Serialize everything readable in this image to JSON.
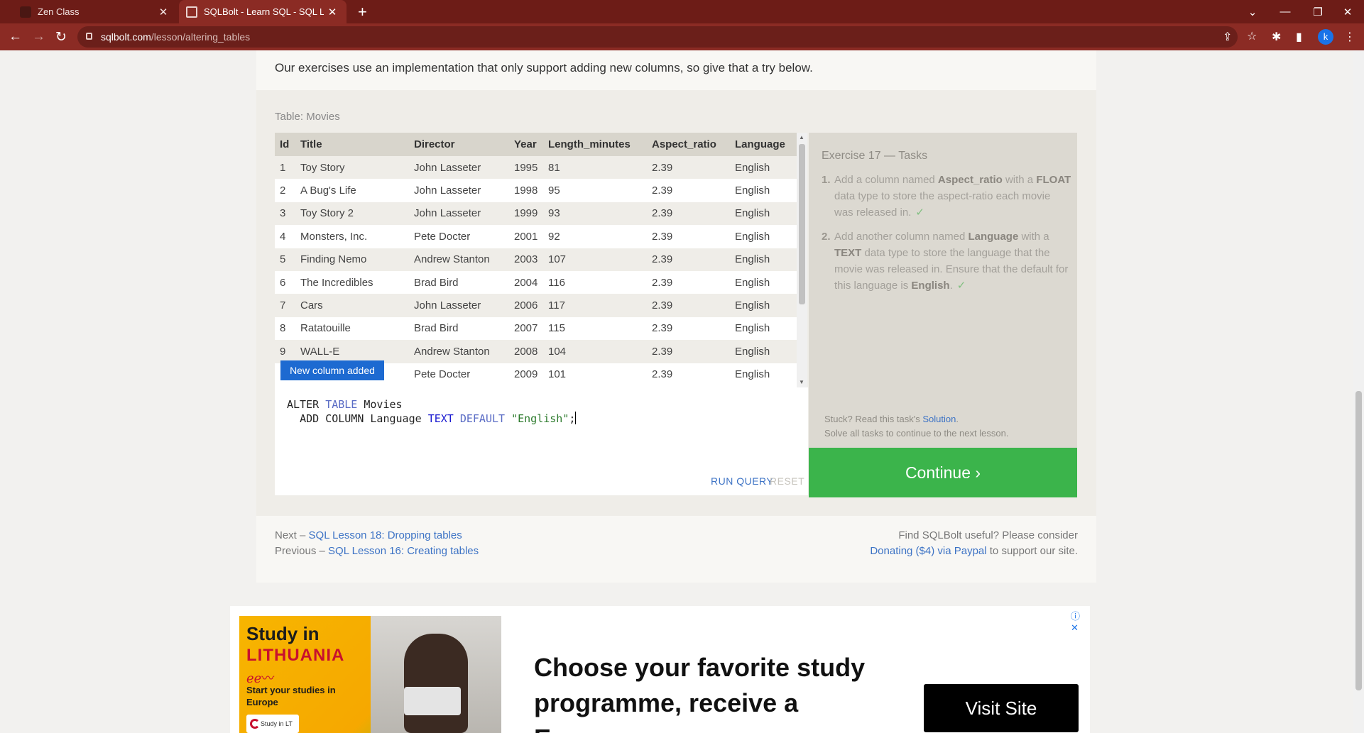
{
  "browser": {
    "tabs": [
      {
        "title": "Zen Class",
        "active": false
      },
      {
        "title": "SQLBolt - Learn SQL - SQL Lesso",
        "active": true
      }
    ],
    "url_host": "sqlbolt.com",
    "url_path": "/lesson/altering_tables",
    "profile_initial": "k"
  },
  "lesson": {
    "intro": "Our exercises use an implementation that only support adding new columns, so give that a try below."
  },
  "table": {
    "caption": "Table: Movies",
    "columns": [
      "Id",
      "Title",
      "Director",
      "Year",
      "Length_minutes",
      "Aspect_ratio",
      "Language"
    ],
    "rows": [
      [
        "1",
        "Toy Story",
        "John Lasseter",
        "1995",
        "81",
        "2.39",
        "English"
      ],
      [
        "2",
        "A Bug's Life",
        "John Lasseter",
        "1998",
        "95",
        "2.39",
        "English"
      ],
      [
        "3",
        "Toy Story 2",
        "John Lasseter",
        "1999",
        "93",
        "2.39",
        "English"
      ],
      [
        "4",
        "Monsters, Inc.",
        "Pete Docter",
        "2001",
        "92",
        "2.39",
        "English"
      ],
      [
        "5",
        "Finding Nemo",
        "Andrew Stanton",
        "2003",
        "107",
        "2.39",
        "English"
      ],
      [
        "6",
        "The Incredibles",
        "Brad Bird",
        "2004",
        "116",
        "2.39",
        "English"
      ],
      [
        "7",
        "Cars",
        "John Lasseter",
        "2006",
        "117",
        "2.39",
        "English"
      ],
      [
        "8",
        "Ratatouille",
        "Brad Bird",
        "2007",
        "115",
        "2.39",
        "English"
      ],
      [
        "9",
        "WALL-E",
        "Andrew Stanton",
        "2008",
        "104",
        "2.39",
        "English"
      ],
      [
        "",
        "",
        "Pete Docter",
        "2009",
        "101",
        "2.39",
        "English"
      ]
    ],
    "badge": "New column added"
  },
  "editor": {
    "line1_kw1": "ALTER",
    "line1_kw2": "TABLE",
    "line1_name": "Movies",
    "line2_kw1": "ADD COLUMN",
    "line2_name": "Language",
    "line2_type": "TEXT",
    "line2_kw2": "DEFAULT",
    "line2_str": "\"English\"",
    "line2_end": ";",
    "run_label": "RUN QUERY",
    "reset_label": "RESET"
  },
  "tasks": {
    "heading": "Exercise 17 — Tasks",
    "items": [
      {
        "num": "1.",
        "p1": "Add a column named ",
        "b1": "Aspect_ratio",
        "p2": " with a ",
        "b2": "FLOAT",
        "p3": " data type to store the aspect-ratio each movie was released in.",
        "check": "✓"
      },
      {
        "num": "2.",
        "p1": "Add another column named ",
        "b1": "Language",
        "p2": " with a ",
        "b2": "TEXT",
        "p3": " data type to store the language that the movie was released in. Ensure that the default for this language is ",
        "b3": "English",
        "p4": ".",
        "check": "✓"
      }
    ],
    "stuck_text": "Stuck? Read this task's ",
    "solution_link": "Solution",
    "stuck_end": ".",
    "solve_all": "Solve all tasks to continue to the next lesson.",
    "continue_label": "Continue ›"
  },
  "nav": {
    "next_prefix": "Next – ",
    "next_link": "SQL Lesson 18: Dropping tables",
    "prev_prefix": "Previous – ",
    "prev_link": "SQL Lesson 16: Creating tables",
    "support_line1": "Find SQLBolt useful? Please consider",
    "support_link": "Donating ($4) via Paypal",
    "support_end": " to support our site."
  },
  "ad": {
    "line1": "Study in",
    "line2": "LITHUANIA",
    "sub": "Start your studies in Europe",
    "logo": "Study in LT",
    "headline": "Choose your favorite study programme, receive a European",
    "cta": "Visit Site"
  },
  "colors": {
    "accent_link": "#3d73c5",
    "continue_green": "#3bb44b",
    "badge_blue": "#1d6ad1",
    "browser_frame": "#8b2b24"
  }
}
